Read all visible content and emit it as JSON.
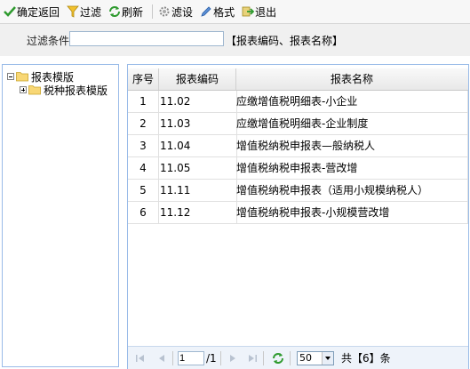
{
  "toolbar": {
    "confirm_label": "确定返回",
    "filter_label": "过滤",
    "refresh_label": "刷新",
    "filter_settings_label": "滤设",
    "format_label": "格式",
    "exit_label": "退出"
  },
  "filter": {
    "label": "过滤条件",
    "value": "",
    "hint": "【报表编码、报表名称】"
  },
  "tree": {
    "root_label": "报表模版",
    "child_label": "税种报表模版"
  },
  "grid": {
    "columns": [
      "序号",
      "报表编码",
      "报表名称"
    ],
    "rows": [
      {
        "no": "1",
        "code": "11.02",
        "name": "应缴增值税明细表-小企业"
      },
      {
        "no": "2",
        "code": "11.03",
        "name": "应缴增值税明细表-企业制度"
      },
      {
        "no": "3",
        "code": "11.04",
        "name": "增值税纳税申报表—般纳税人"
      },
      {
        "no": "4",
        "code": "11.05",
        "name": "增值税纳税申报表-营改增"
      },
      {
        "no": "5",
        "code": "11.11",
        "name": "增值税纳税申报表（适用小规模纳税人）"
      },
      {
        "no": "6",
        "code": "11.12",
        "name": "增值税纳税申报表-小规模营改增"
      }
    ]
  },
  "pager": {
    "page": "1",
    "total_pages": "/1",
    "page_size": "50",
    "summary": "共【6】条"
  },
  "colors": {
    "border_blue": "#99bbe8",
    "toolbar_bg": "#f7f7f7",
    "pager_bg": "#eef3fa"
  }
}
